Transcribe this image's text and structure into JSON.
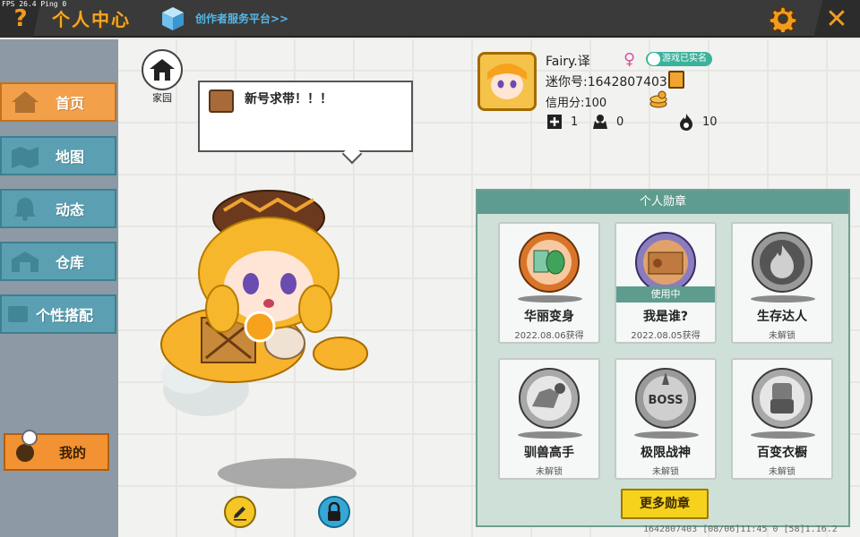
{
  "debug": {
    "fps_text": "FPS 26.4  Ping 0"
  },
  "header": {
    "help_icon": "question-mark-icon",
    "title": "个人中心",
    "creator_link": "创作者服务平台>>",
    "settings_icon": "gear-icon",
    "close_icon": "close-icon"
  },
  "sidebar": {
    "items": [
      {
        "label": "首页",
        "icon": "home-icon",
        "active": true
      },
      {
        "label": "地图",
        "icon": "map-icon",
        "active": false
      },
      {
        "label": "动态",
        "icon": "bell-icon",
        "active": false
      },
      {
        "label": "仓库",
        "icon": "warehouse-icon",
        "active": false
      },
      {
        "label": "个性搭配",
        "icon": "outfit-icon",
        "active": false
      }
    ],
    "mine_label": "我的"
  },
  "scene": {
    "home_label": "家园",
    "bubble_text": "新号求带！！！"
  },
  "profile": {
    "name": "Fairy.译",
    "gender_symbol": "♀",
    "verified_label": "游戏已实名",
    "mini_id": "迷你号:1642807403",
    "credit": "信用分:100",
    "stats": [
      {
        "icon": "plus-friend-icon",
        "value": "1"
      },
      {
        "icon": "fans-icon",
        "value": "0"
      },
      {
        "icon": "flame-icon",
        "value": "10"
      }
    ]
  },
  "badges": {
    "header": "个人勋章",
    "items": [
      {
        "name": "华丽变身",
        "status": "2022.08.06获得",
        "in_use": false,
        "unlocked": true
      },
      {
        "name": "我是谁?",
        "status": "2022.08.05获得",
        "in_use": true,
        "in_use_label": "使用中",
        "unlocked": true
      },
      {
        "name": "生存达人",
        "status": "未解锁",
        "in_use": false,
        "unlocked": false
      },
      {
        "name": "驯兽高手",
        "status": "未解锁",
        "in_use": false,
        "unlocked": false
      },
      {
        "name": "极限战神",
        "status": "未解锁",
        "in_use": false,
        "unlocked": false,
        "medal_text": "BOSS"
      },
      {
        "name": "百变衣橱",
        "status": "未解锁",
        "in_use": false,
        "unlocked": false
      }
    ],
    "more_label": "更多勋章"
  },
  "footer": {
    "text": "1642807403  [08/06]11:45 0  [58]1.16.2"
  },
  "colors": {
    "accent_orange": "#f3a04a",
    "teal": "#5e9c8f",
    "sidebar_blue": "#5aa0b2",
    "title_gold": "#f5a623"
  }
}
